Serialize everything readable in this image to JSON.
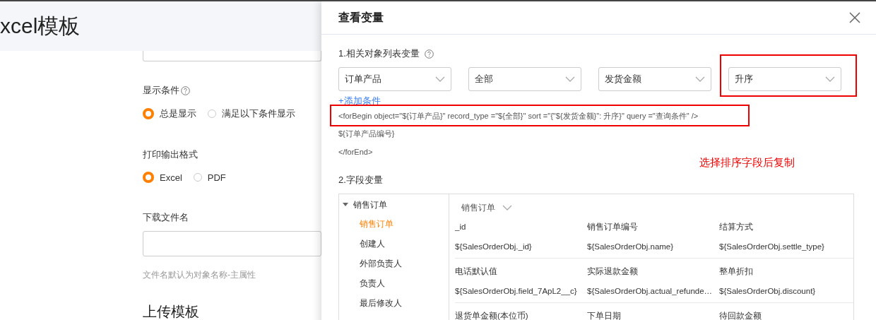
{
  "page": {
    "title": "xcel模板"
  },
  "form": {
    "display_condition": {
      "label": "显示条件",
      "options": [
        {
          "label": "总是显示",
          "selected": true
        },
        {
          "label": "满足以下条件显示",
          "selected": false
        }
      ]
    },
    "output_format": {
      "label": "打印输出格式",
      "options": [
        {
          "label": "Excel",
          "selected": true
        },
        {
          "label": "PDF",
          "selected": false
        }
      ]
    },
    "file_name": {
      "label": "下载文件名",
      "hint": "文件名默认为对象名称-主属性"
    },
    "upload_title": "上传模板"
  },
  "modal": {
    "title": "查看变量",
    "section_1": {
      "label": "1.相关对象列表变量",
      "selects": [
        {
          "value": "订单产品",
          "highlighted": false
        },
        {
          "value": "全部",
          "highlighted": false
        },
        {
          "value": "发货金额",
          "highlighted": false
        },
        {
          "value": "升序",
          "highlighted": true
        }
      ],
      "add_condition": "+添加条件",
      "code_lines": [
        {
          "text": "<forBegin object=\"${订单产品}\" record_type =\"${全部}\" sort =\"{\"${发货金额}\": 升序}\" query =\"查询条件\" />",
          "highlighted": true
        },
        {
          "text": "${订单产品编号}",
          "highlighted": false
        },
        {
          "text": "</forEnd>",
          "highlighted": false
        }
      ],
      "note": "选择排序字段后复制"
    },
    "section_2": {
      "label": "2.字段变量",
      "tree": {
        "label": "销售订单",
        "expanded": true,
        "children": [
          {
            "label": "销售订单",
            "selected": true
          },
          {
            "label": "创建人",
            "selected": false
          },
          {
            "label": "外部负责人",
            "selected": false
          },
          {
            "label": "负责人",
            "selected": false
          },
          {
            "label": "最后修改人",
            "selected": false
          }
        ]
      },
      "object_dropdown": "销售订单",
      "field_groups": [
        {
          "fields": [
            {
              "name": "_id",
              "value": "${SalesOrderObj._id}"
            },
            {
              "name": "销售订单编号",
              "value": "${SalesOrderObj.name}"
            },
            {
              "name": "结算方式",
              "value": "${SalesOrderObj.settle_type}"
            }
          ]
        },
        {
          "fields": [
            {
              "name": "电话默认值",
              "value": "${SalesOrderObj.field_7ApL2__c}"
            },
            {
              "name": "实际退款金额",
              "value": "${SalesOrderObj.actual_refunde…"
            },
            {
              "name": "整单折扣",
              "value": "${SalesOrderObj.discount}"
            }
          ]
        },
        {
          "fields": [
            {
              "name": "退货单金额(本位币)"
            },
            {
              "name": "下单日期"
            },
            {
              "name": "待回款金额"
            }
          ]
        }
      ]
    }
  }
}
